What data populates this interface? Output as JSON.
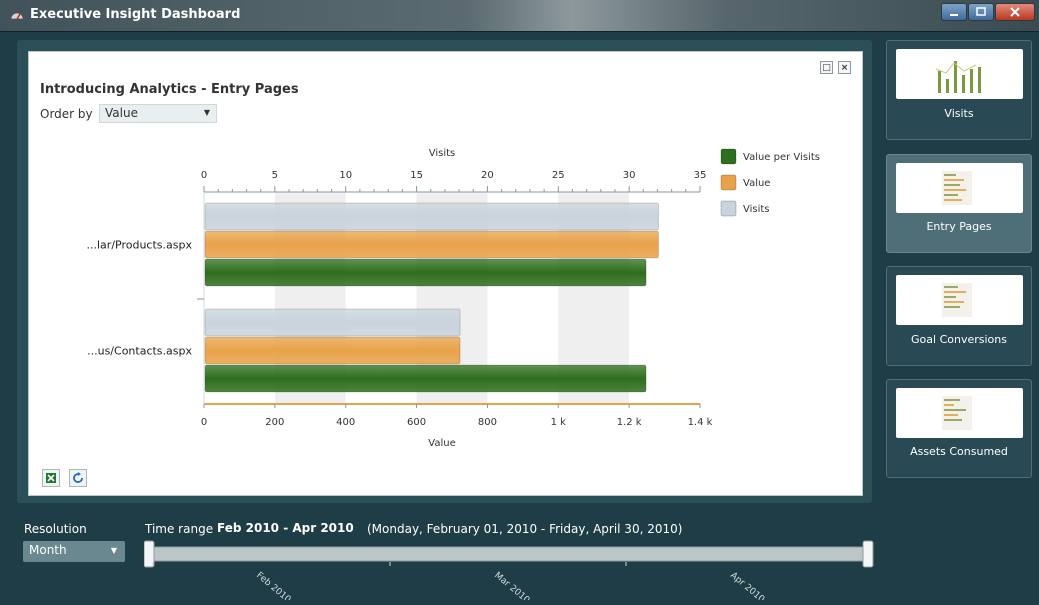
{
  "window": {
    "title": "Executive Insight Dashboard"
  },
  "card": {
    "title": "Introducing Analytics - Entry Pages",
    "order_by_label": "Order by",
    "order_by_value": "Value",
    "restore_glyph": "□",
    "close_glyph": "×"
  },
  "chart_data": {
    "type": "bar",
    "orientation": "horizontal",
    "categories": [
      "...lar/Products.aspx",
      "...us/Contacts.aspx"
    ],
    "series": [
      {
        "name": "Visits",
        "axis": "top",
        "color": "#c9d3dd",
        "values": [
          32,
          18
        ]
      },
      {
        "name": "Value",
        "axis": "bottom",
        "color": "#e8a24a",
        "values": [
          1280,
          720
        ]
      },
      {
        "name": "Value per Visits",
        "axis": "bottom",
        "color": "#2e6e1d",
        "values": [
          1245,
          1245
        ]
      }
    ],
    "legend_order": [
      "Value per Visits",
      "Value",
      "Visits"
    ],
    "top_axis": {
      "label": "Visits",
      "min": 0,
      "max": 35,
      "ticks": [
        "0",
        "5",
        "10",
        "15",
        "20",
        "25",
        "30",
        "35"
      ]
    },
    "bottom_axis": {
      "label": "Value",
      "min": 0,
      "max": 1400,
      "ticks": [
        "0",
        "200",
        "400",
        "600",
        "800",
        "1 k",
        "1.2 k",
        "1.4 k"
      ]
    },
    "legend_position": "right"
  },
  "sidebar": {
    "items": [
      {
        "label": "Visits",
        "active": false
      },
      {
        "label": "Entry Pages",
        "active": true
      },
      {
        "label": "Goal Conversions",
        "active": false
      },
      {
        "label": "Assets Consumed",
        "active": false
      }
    ]
  },
  "bottom": {
    "resolution_label": "Resolution",
    "resolution_value": "Month",
    "time_range_label": "Time range",
    "time_range_value": "Feb 2010 - Apr 2010",
    "time_range_detail": "(Monday, February 01, 2010 - Friday, April 30, 2010)",
    "months": [
      "Feb 2010",
      "Mar 2010",
      "Apr 2010"
    ]
  },
  "colors": {
    "background": "#1e3d47",
    "card": "#ffffff",
    "accent_green": "#2e6e1d",
    "accent_orange": "#e8a24a",
    "accent_grey": "#c9d3dd"
  }
}
